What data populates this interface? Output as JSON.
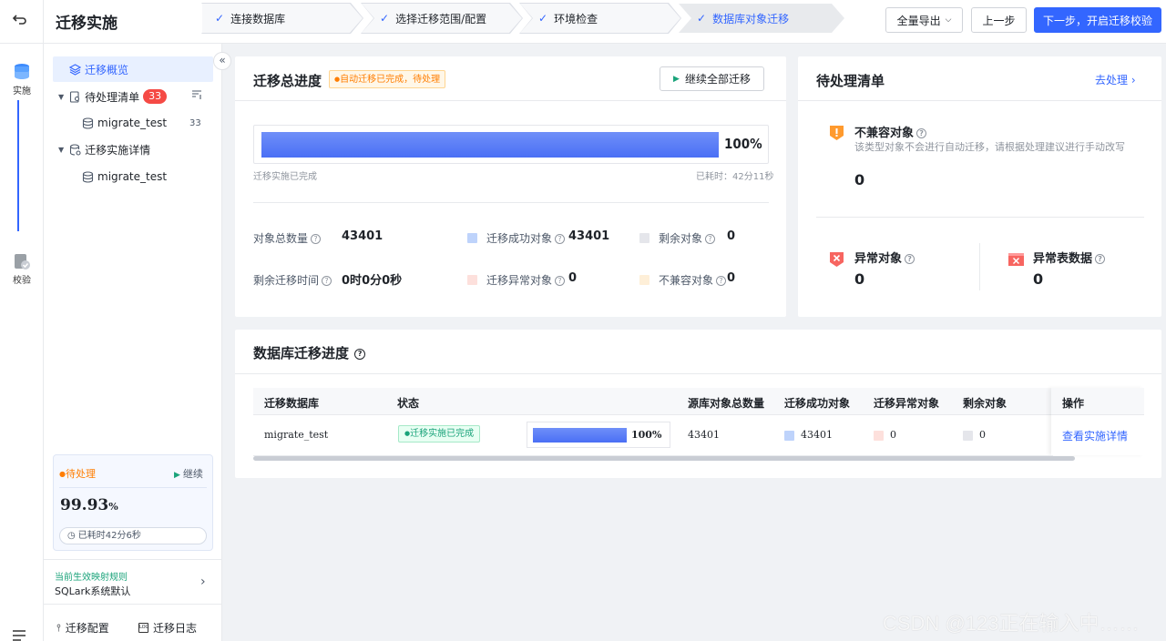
{
  "app": {
    "title": "迁移实施"
  },
  "rail": {
    "items": [
      {
        "label": "实施"
      },
      {
        "label": "校验"
      }
    ]
  },
  "steps": [
    {
      "label": "连接数据库",
      "state": "done"
    },
    {
      "label": "选择迁移范围/配置",
      "state": "done"
    },
    {
      "label": "环境检查",
      "state": "done"
    },
    {
      "label": "数据库对象迁移",
      "state": "active"
    }
  ],
  "header_actions": {
    "export": "全量导出",
    "prev": "上一步",
    "next": "下一步，开启迁移校验"
  },
  "sidebar": {
    "overview": "迁移概览",
    "pending": {
      "label": "待处理清单",
      "badge": "33",
      "child": {
        "label": "migrate_test",
        "count": "33"
      }
    },
    "details": {
      "label": "迁移实施详情",
      "child": {
        "label": "migrate_test"
      }
    },
    "status_card": {
      "status": "待处理",
      "continue": "继续",
      "percent": "99.93",
      "percent_unit": "%",
      "elapsed": "已耗时42分6秒"
    },
    "rule": {
      "title": "当前生效映射规则",
      "value": "SQLark系统默认"
    },
    "footer": {
      "config": "迁移配置",
      "log": "迁移日志"
    }
  },
  "progress_card": {
    "title": "迁移总进度",
    "tag": "自动迁移已完成，待处理",
    "continue_all": "继续全部迁移",
    "percent": "100%",
    "progress": 1.0,
    "status_text": "迁移实施已完成",
    "elapsed": "已耗时：42分11秒",
    "stats": {
      "total_label": "对象总数量",
      "total": "43401",
      "success_label": "迁移成功对象",
      "success": "43401",
      "remaining_label": "剩余对象",
      "remaining": "0",
      "time_label": "剩余迁移时间",
      "time_h": "0",
      "time_h_unit": "时",
      "time_m": "0",
      "time_m_unit": "分",
      "time_s": "0",
      "time_s_unit": "秒",
      "error_label": "迁移异常对象",
      "error": "0",
      "incompat_label": "不兼容对象",
      "incompat": "0"
    },
    "colors": {
      "success": "#bed3fb",
      "remaining": "#e5e6eb",
      "error": "#fde0dc",
      "incompat": "#feefd8"
    }
  },
  "pending_card": {
    "title": "待处理清单",
    "action": "去处理",
    "incompat": {
      "title": "不兼容对象",
      "desc": "该类型对象不会进行自动迁移，请根据处理建议进行手动改写",
      "value": "0"
    },
    "abnormal": {
      "title": "异常对象",
      "value": "0"
    },
    "abnormal_table": {
      "title": "异常表数据",
      "value": "0"
    }
  },
  "db_progress": {
    "title": "数据库迁移进度",
    "columns": [
      "迁移数据库",
      "状态",
      "",
      "源库对象总数量",
      "迁移成功对象",
      "迁移异常对象",
      "剩余对象",
      "操作"
    ],
    "rows": [
      {
        "db": "migrate_test",
        "status": "迁移实施已完成",
        "progress": 1.0,
        "percent": "100%",
        "total": "43401",
        "success": "43401",
        "error": "0",
        "remaining": "0",
        "action": "查看实施详情"
      }
    ]
  },
  "watermark": "CSDN @123正在输入中……"
}
